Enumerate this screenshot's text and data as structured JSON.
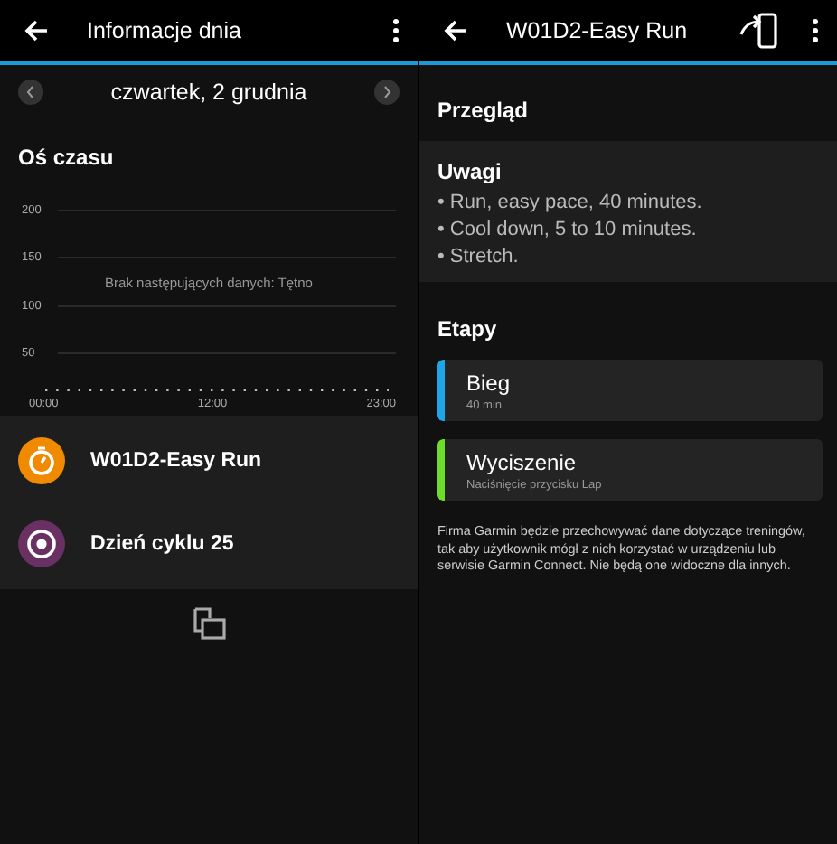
{
  "left_screen": {
    "title": "Informacje dnia",
    "date": "czwartek, 2 grudnia",
    "timeline_title": "Oś czasu",
    "chart": {
      "y_labels": [
        "200",
        "150",
        "100",
        "50"
      ],
      "x_labels": [
        "00:00",
        "12:00",
        "23:00"
      ],
      "empty_message": "Brak następujących danych: Tętno"
    },
    "activities": [
      {
        "kind": "workout",
        "label": "W01D2-Easy Run",
        "color": "#f08a00"
      },
      {
        "kind": "cycle",
        "label": "Dzień cyklu 25",
        "color": "#6a2f63"
      }
    ]
  },
  "right_screen": {
    "title": "W01D2-Easy Run",
    "overview_title": "Przegląd",
    "notes": {
      "title": "Uwagi",
      "lines": [
        "• Run, easy pace, 40 minutes.",
        "• Cool down, 5 to 10 minutes.",
        "• Stretch."
      ]
    },
    "steps_title": "Etapy",
    "steps": [
      {
        "name": "Bieg",
        "detail": "40 min",
        "color": "#1ea7e8"
      },
      {
        "name": "Wyciszenie",
        "detail": "Naciśnięcie przycisku Lap",
        "color": "#6fdc2a"
      }
    ],
    "disclaimer": "Firma Garmin będzie przechowywać dane dotyczące treningów, tak aby użytkownik mógł z nich korzystać w urządzeniu lub serwisie Garmin Connect. Nie będą one widoczne dla innych."
  }
}
